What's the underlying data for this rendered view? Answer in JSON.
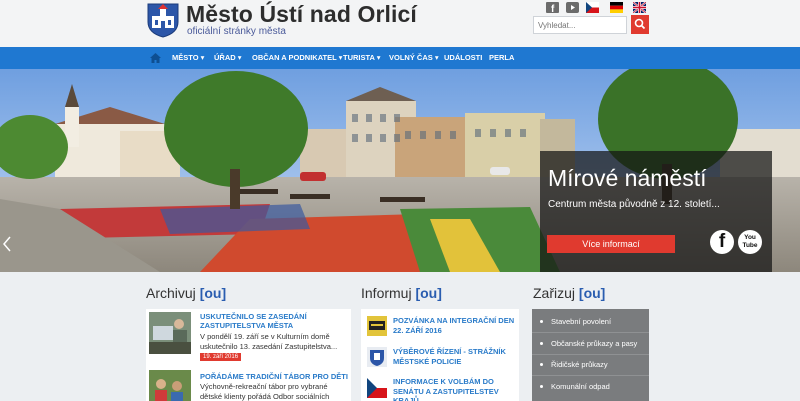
{
  "header": {
    "title": "Město Ústí nad Orlicí",
    "subtitle": "oficiální stránky města",
    "search_placeholder": "Vyhledat...",
    "icons": [
      "facebook-icon",
      "youtube-icon",
      "flag-cz-icon",
      "flag-de-icon",
      "flag-en-icon"
    ]
  },
  "nav": {
    "home_icon": "home-icon",
    "items": [
      "MĚSTO",
      "ÚŘAD",
      "OBČAN A PODNIKATEL",
      "TURISTA",
      "VOLNÝ ČAS",
      "UDÁLOSTI",
      "PERLA"
    ]
  },
  "hero": {
    "title": "Mírové náměstí",
    "subtitle": "Centrum města původně z 12. století...",
    "button": "Více informací",
    "fb_letter": "f",
    "yt_text": "You\nTube"
  },
  "archiv": {
    "title_word": "Archivuj",
    "title_ou": "[ou]",
    "items": [
      {
        "title": "USKUTEČNILO SE ZASEDÁNÍ ZASTUPITELSTVA MĚSTA",
        "text": "V pondělí 19. září se v Kulturním domě uskutečnilo 13. zasedání Zastupitelstva...",
        "date": "19. září 2016"
      },
      {
        "title": "POŘÁDÁME TRADIČNÍ TÁBOR PRO DĚTI",
        "text": "Výchovně-rekreační tábor pro vybrané dětské klienty pořádá Odbor sociálních služeb..."
      }
    ]
  },
  "informuj": {
    "title_word": "Informuj",
    "title_ou": "[ou]",
    "items": [
      "POZVÁNKA NA INTEGRAČNÍ DEN 22. ZÁŘÍ 2016",
      "VÝBĚROVÉ ŘÍZENÍ - STRÁŽNÍK MĚSTSKÉ POLICIE",
      "INFORMACE K VOLBÁM DO SENÁTU A ZASTUPITELSTEV KRAJŮ"
    ]
  },
  "zarizuj": {
    "title_word": "Zařizuj",
    "title_ou": "[ou]",
    "items": [
      "Stavební povolení",
      "Občanské průkazy a pasy",
      "Řidičské průkazy",
      "Komunální odpad"
    ]
  },
  "colors": {
    "nav_blue": "#1f78d1",
    "accent_red": "#e03a2f",
    "link_blue": "#2a7bc9"
  }
}
